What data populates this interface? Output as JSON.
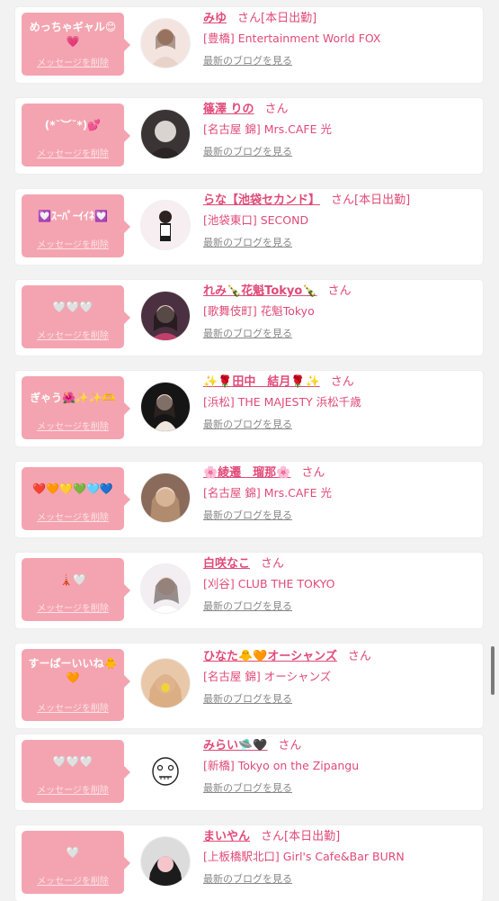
{
  "common": {
    "delete_label": "メッセージを削除",
    "blog_label": "最新のブログを見る",
    "san": "さん",
    "accent": "#e04a78",
    "bubble_color": "#f4a4b0"
  },
  "entries": [
    {
      "message": "めっちゃギャル😊💗",
      "name": "みゆ",
      "today": "[本日出勤]",
      "store": "[豊橋] Entertainment World FOX",
      "avatar": "avatar-photo"
    },
    {
      "message": "(*˘︶˘*)💕",
      "name": "篠澤 りの",
      "today": "",
      "store": "[名古屋 錦] Mrs.CAFE 光",
      "avatar": "avatar-photo"
    },
    {
      "message": "💟ｽｰﾊﾟｰｲｲﾈ💟",
      "name": "らな【池袋セカンド】",
      "today": "[本日出勤]",
      "store": "[池袋東口] SECOND",
      "avatar": "avatar-photo"
    },
    {
      "message": "🤍🤍🤍",
      "name": "れみ🍾花魁Tokyo🍾",
      "today": "",
      "store": "[歌舞伎町] 花魁Tokyo",
      "avatar": "avatar-photo"
    },
    {
      "message": "ぎゃう🌺✨✨🫶",
      "name": "✨🌹田中　結月🌹✨",
      "today": "",
      "store": "[浜松] THE MAJESTY 浜松千歳",
      "avatar": "avatar-photo"
    },
    {
      "message": "❤️🧡💛💚🩵💙",
      "name": "🌸綾遷　瑠那🌸",
      "today": "",
      "store": "[名古屋 錦] Mrs.CAFE 光",
      "avatar": "avatar-photo"
    },
    {
      "message": "🗼🤍",
      "name": "白咲なこ",
      "today": "",
      "store": "[刈谷] CLUB THE TOKYO",
      "avatar": "avatar-photo"
    },
    {
      "message": "すーぱーいいね🐥🧡",
      "name": "ひなた🐥🧡オーシャンズ",
      "today": "",
      "store": "[名古屋 錦] オーシャンズ",
      "avatar": "avatar-photo"
    },
    {
      "message": "🤍🤍🤍",
      "name": "みらい🛸🖤",
      "today": "",
      "store": "[新橋] Tokyo on the Zipangu",
      "avatar": "avatar-doodle"
    },
    {
      "message": "🤍",
      "name": "まいやん",
      "today": "[本日出勤]",
      "store": "[上板橋駅北口] Girl's Cafe&Bar BURN",
      "avatar": "avatar-photo"
    }
  ]
}
